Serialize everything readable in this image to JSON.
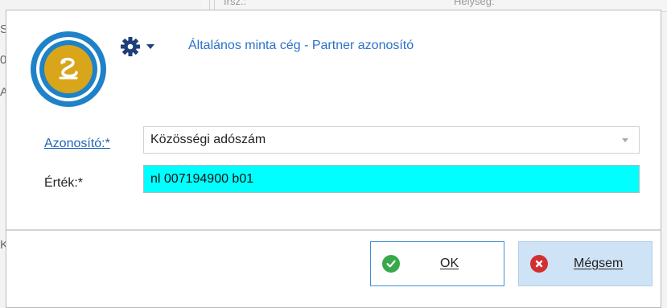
{
  "background": {
    "col_left": "Irsz.:",
    "col_right": "Helység:",
    "frag_1": "S",
    "frag_2": "0",
    "frag_3": "A",
    "frag_4": "K"
  },
  "dialog": {
    "title": "Általános minta cég - Partner azonosító",
    "logo_icon": "snake-logo-icon",
    "settings_icon": "gear-icon",
    "accent_color": "#1e82c8",
    "fields": {
      "identifier_label": "Azonosító:*",
      "identifier_value": "Közösségi adószám",
      "value_label": "Érték:*",
      "value_value": "nl 007194900 b01",
      "value_highlight_color": "#00ffff"
    },
    "buttons": {
      "ok_label": "OK",
      "cancel_label": "Mégsem"
    }
  }
}
